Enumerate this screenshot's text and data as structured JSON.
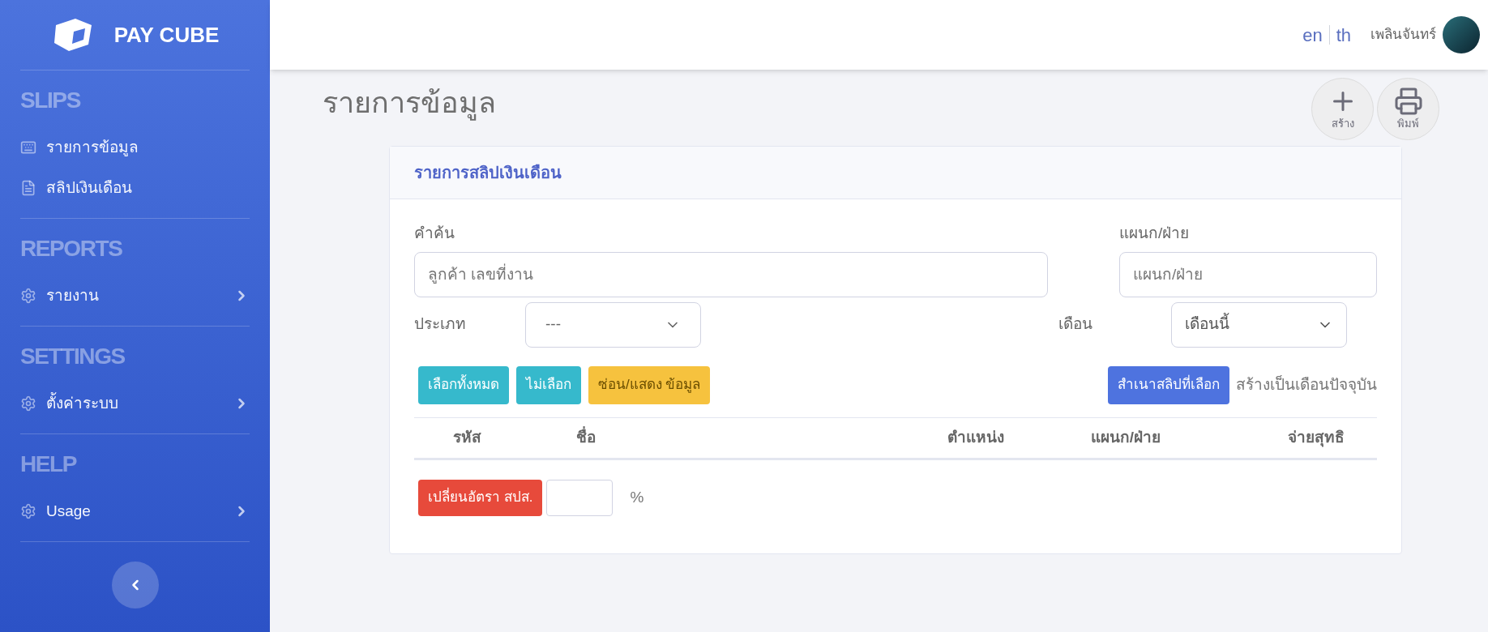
{
  "brand": {
    "name": "PAY CUBE"
  },
  "sidebar": {
    "sections": [
      {
        "title": "SLIPS",
        "items": [
          {
            "label": "รายการข้อมูล",
            "submenu": false
          },
          {
            "label": "สลิปเงินเดือน",
            "submenu": false
          }
        ]
      },
      {
        "title": "REPORTS",
        "items": [
          {
            "label": "รายงาน",
            "submenu": true
          }
        ]
      },
      {
        "title": "SETTINGS",
        "items": [
          {
            "label": "ตั้งค่าระบบ",
            "submenu": true
          }
        ]
      },
      {
        "title": "HELP",
        "items": [
          {
            "label": "Usage",
            "submenu": true
          }
        ]
      }
    ]
  },
  "header": {
    "languages": [
      "en",
      "th"
    ],
    "user": "เพลินจันทร์"
  },
  "page": {
    "title": "รายการข้อมูล",
    "actions": [
      {
        "label": "สร้าง"
      },
      {
        "label": "พิมพ์"
      }
    ]
  },
  "card": {
    "title": "รายการสลิปเงินเดือน",
    "search": {
      "label": "คำค้น",
      "placeholder": "ลูกค้า เลขที่งาน"
    },
    "department": {
      "label": "แผนก/ฝ่าย",
      "placeholder": "แผนก/ฝ่าย"
    },
    "type": {
      "label": "ประเภท",
      "value": "---"
    },
    "month": {
      "label": "เดือน",
      "value": "เดือนนี้"
    },
    "buttons": [
      {
        "label": "เลือกทั้งหมด",
        "kind": "info"
      },
      {
        "label": "ไม่เลือก",
        "kind": "info"
      },
      {
        "label": "ซ่อน/แสดง ข้อมูล",
        "kind": "warning"
      }
    ],
    "copy_button": {
      "label": "สำเนาสลิปที่เลือก"
    },
    "copy_note": "สร้างเป็นเดือนปัจจุบัน",
    "table": {
      "columns": [
        "รหัส",
        "ชื่อ",
        "ตำแหน่ง",
        "แผนก/ฝ่าย",
        "จ่ายสุทธิ"
      ]
    },
    "rate_button": {
      "label": "เปลี่ยนอัตรา สปส."
    },
    "rate_unit": "%"
  }
}
